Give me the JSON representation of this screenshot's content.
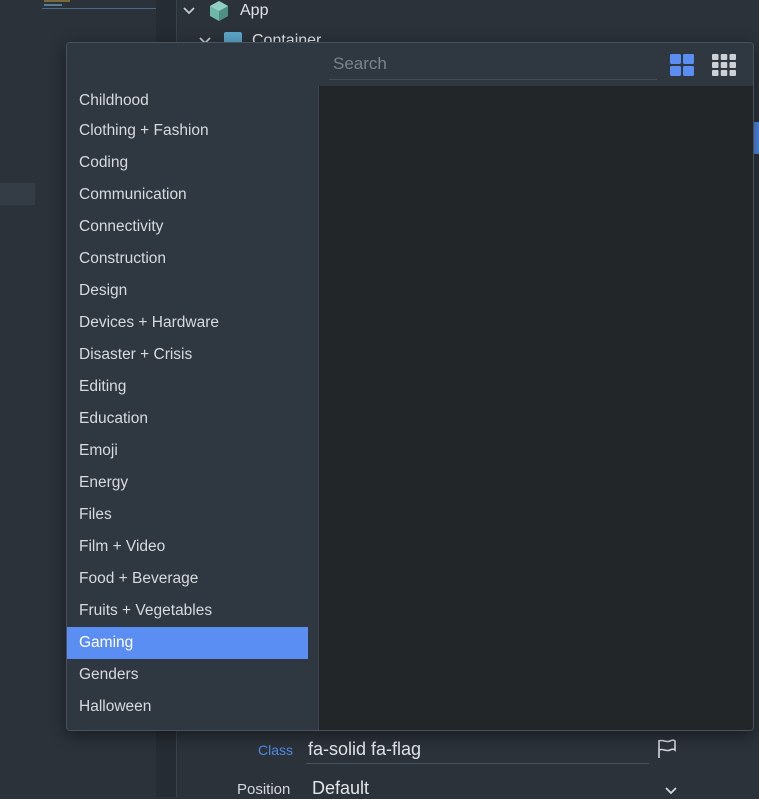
{
  "tree": {
    "app_label": "App",
    "container_label": "Container"
  },
  "popup": {
    "search": {
      "placeholder": "Search",
      "value": ""
    },
    "view_large_icon": "large-grid-icon",
    "view_small_icon": "small-grid-icon",
    "accent_color": "#5b8ef2",
    "categories": [
      "Childhood",
      "Clothing + Fashion",
      "Coding",
      "Communication",
      "Connectivity",
      "Construction",
      "Design",
      "Devices + Hardware",
      "Disaster + Crisis",
      "Editing",
      "Education",
      "Emoji",
      "Energy",
      "Files",
      "Film + Video",
      "Food + Beverage",
      "Fruits + Vegetables",
      "Gaming",
      "Genders",
      "Halloween"
    ],
    "selected_category": "Gaming"
  },
  "properties": {
    "class_label": "Class",
    "class_value": "fa-solid fa-flag",
    "class_icon": "flag-icon",
    "position_label": "Position",
    "position_value": "Default"
  }
}
